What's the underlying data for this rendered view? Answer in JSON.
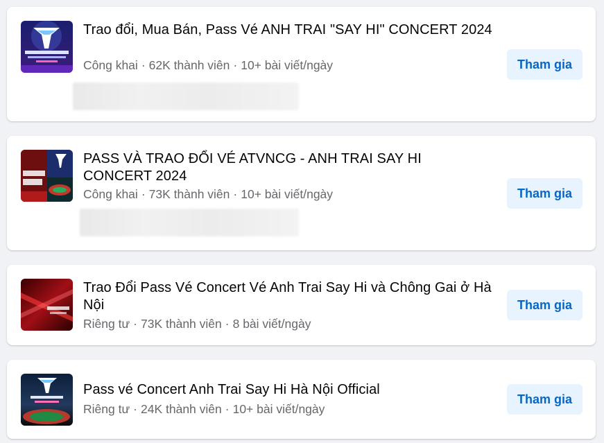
{
  "groups": [
    {
      "title": "Trao đổi, Mua Bán, Pass Vé ANH TRAI \"SAY HI\" CONCERT 2024",
      "privacy": "Công khai",
      "members": "62K thành viên",
      "posts": "10+ bài viết/ngày",
      "join_label": "Tham gia",
      "thumb_icon": "concert-poster-logo"
    },
    {
      "title": "PASS VÀ TRAO ĐỔI VÉ ATVNCG - ANH TRAI SAY HI CONCERT 2024",
      "privacy": "Công khai",
      "members": "73K thành viên",
      "posts": "10+ bài viết/ngày",
      "join_label": "Tham gia",
      "thumb_icon": "concert-poster-collage"
    },
    {
      "title": "Trao Đổi Pass Vé Concert Vé Anh Trai Say Hi và Chông Gai ở Hà Nội",
      "privacy": "Riêng tư",
      "members": "73K thành viên",
      "posts": "8 bài viết/ngày",
      "join_label": "Tham gia",
      "thumb_icon": "concert-poster-red"
    },
    {
      "title": "Pass vé Concert Anh Trai Say Hi Hà Nội Official",
      "privacy": "Riêng tư",
      "members": "24K thành viên",
      "posts": "10+ bài viết/ngày",
      "join_label": "Tham gia",
      "thumb_icon": "concert-poster-stadium"
    }
  ],
  "colors": {
    "page_background": "#f0f2f5",
    "card_background": "#ffffff",
    "title_text": "#050505",
    "meta_text": "#65676b",
    "button_background": "#e7f3ff",
    "button_text": "#0866c6"
  }
}
